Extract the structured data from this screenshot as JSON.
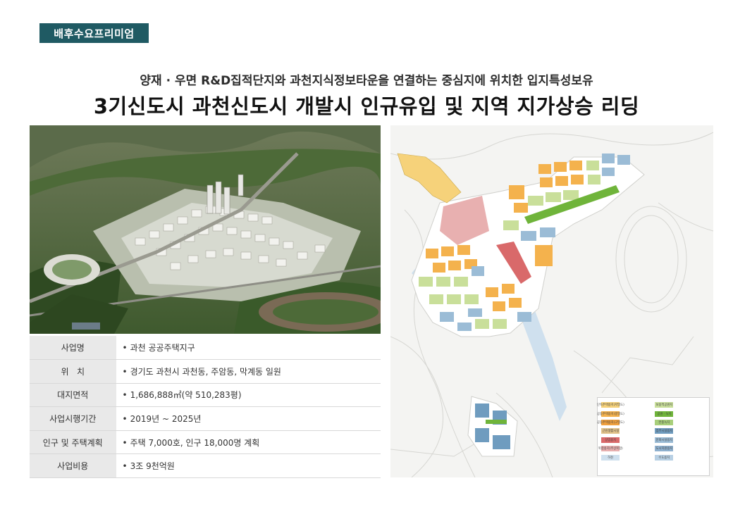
{
  "badge": "배후수요프리미엄",
  "subtitle": "양재 · 우면 R&D집적단지와 과천지식정보타운을 연결하는 중심지에 위치한 입지특성보유",
  "title": "3기신도시 과천신도시 개발시 인규유입 및 지역 지가상승 리딩",
  "info_table": [
    {
      "key": "사업명",
      "value": "과천 공공주택지구"
    },
    {
      "key": "위   치",
      "value": "경기도 과천시 과천동, 주암동, 막계동 일원"
    },
    {
      "key": "대지면적",
      "value": "1,686,888㎡(약 510,283평)"
    },
    {
      "key": "사업시행기간",
      "value": "2019년 ~ 2025년"
    },
    {
      "key": "인구 및 주택계획",
      "value": "주택 7,000호, 인구 18,000명 계획"
    },
    {
      "key": "사업비용",
      "value": "3조 9천억원"
    }
  ],
  "legend": [
    {
      "label": "단독주택용지(저밀도)",
      "color": "#f6d27a"
    },
    {
      "label": "보용적공원지",
      "color": "#c9df9a"
    },
    {
      "label": "공동주택용지(중밀도)",
      "color": "#f4b24d"
    },
    {
      "label": "공원 · 녹지",
      "color": "#6fb43a"
    },
    {
      "label": "공동주택용지(고밀도)",
      "color": "#f0a03c"
    },
    {
      "label": "완충녹지",
      "color": "#a8cf7a"
    },
    {
      "label": "근린생활시설",
      "color": "#e2c38a"
    },
    {
      "label": "업무시설용지",
      "color": "#6f9cbf"
    },
    {
      "label": "상업용지",
      "color": "#d9696a"
    },
    {
      "label": "문화시설용지",
      "color": "#9bbcd6"
    },
    {
      "label": "복합용지(주상복합)",
      "color": "#e8b0b0"
    },
    {
      "label": "도시지원용지",
      "color": "#8fb1cf"
    },
    {
      "label": "하천",
      "color": "#cfe0ee"
    },
    {
      "label": "수도용지",
      "color": "#b8d0e4"
    }
  ],
  "colors": {
    "badge_bg": "#1f5a63",
    "table_key_bg": "#e9e9e9"
  }
}
